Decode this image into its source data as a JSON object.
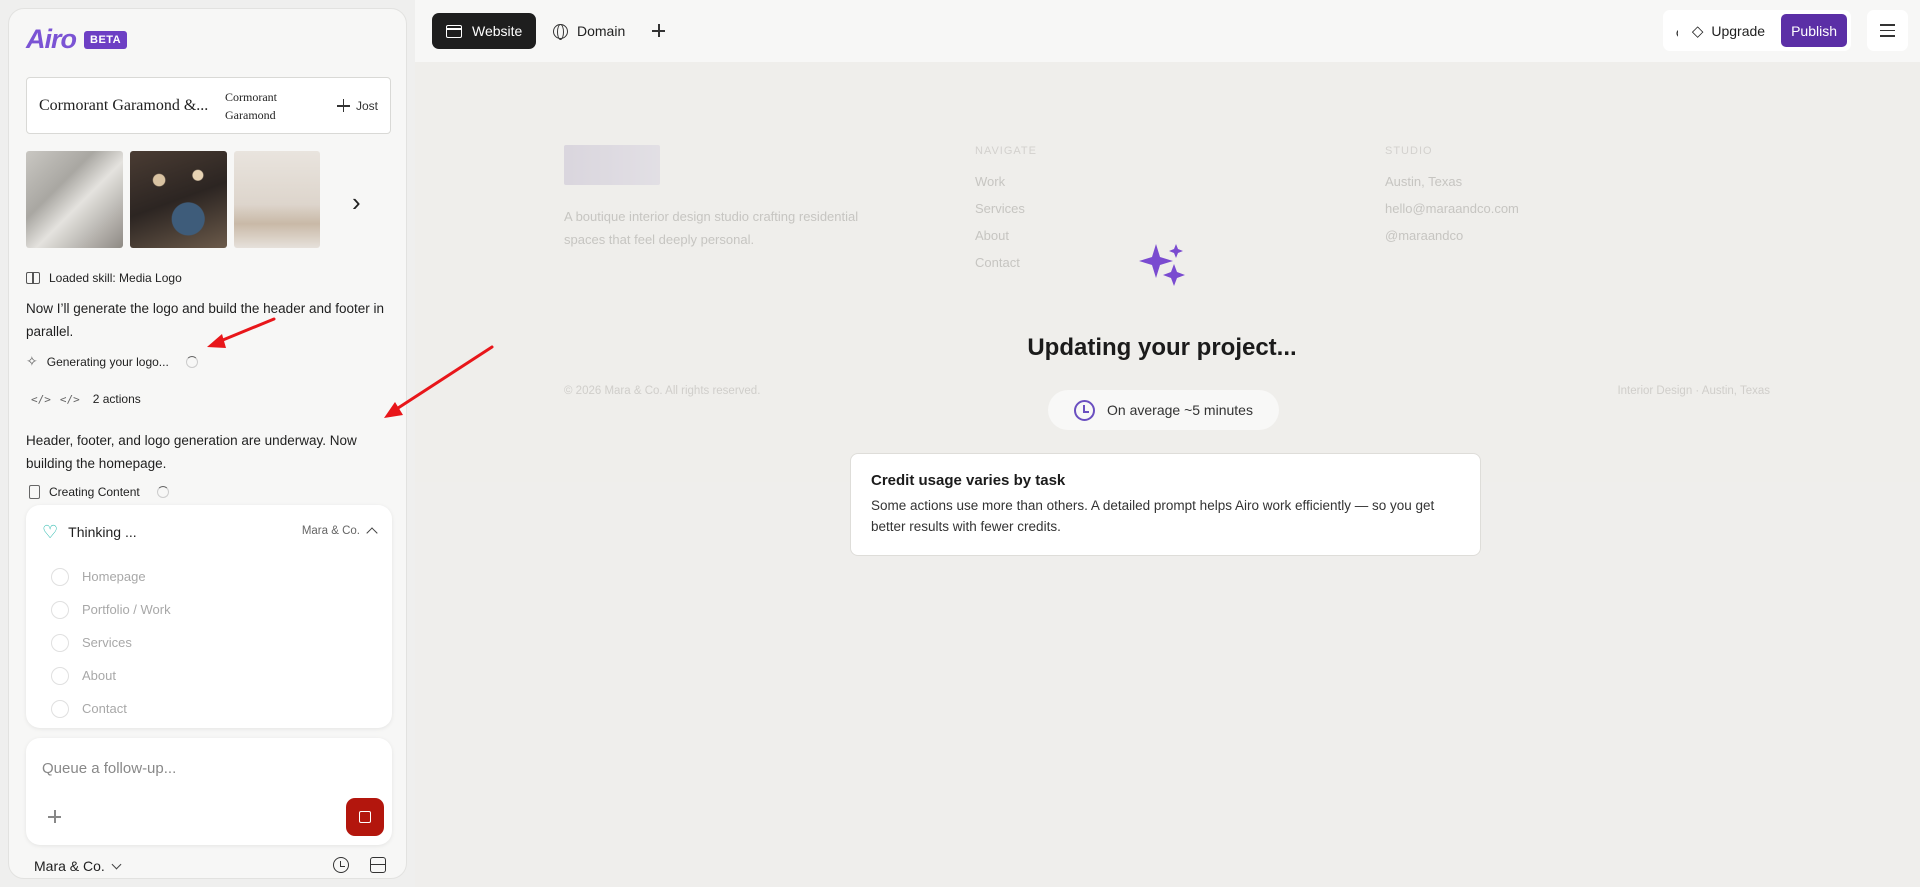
{
  "brand": {
    "name": "Airo",
    "badge": "BETA"
  },
  "font_card": {
    "primary": "Cormorant Garamond &...",
    "secondary": "Cormorant Garamond",
    "add_label": "Jost"
  },
  "chat": {
    "skill_loaded": "Loaded skill: Media Logo",
    "message_1": "Now I’ll generate the logo and build the header and footer in parallel.",
    "status_logo": "Generating your logo...",
    "actions_count": "2 actions",
    "message_2": "Header, footer, and logo generation are underway. Now building the homepage.",
    "status_content": "Creating Content"
  },
  "thinking": {
    "label": "Thinking ...",
    "project": "Mara & Co.",
    "pages": [
      "Homepage",
      "Portfolio / Work",
      "Services",
      "About",
      "Contact"
    ]
  },
  "composer": {
    "placeholder": "Queue a follow-up..."
  },
  "footer": {
    "project": "Mara & Co."
  },
  "topbar": {
    "tab_website": "Website",
    "tab_domain": "Domain",
    "upgrade": "Upgrade",
    "publish": "Publish"
  },
  "preview": {
    "about": "A boutique interior design studio crafting residential spaces that feel deeply personal.",
    "navigate_heading": "NAVIGATE",
    "navigate_items": [
      "Work",
      "Services",
      "About",
      "Contact"
    ],
    "studio_heading": "STUDIO",
    "studio_items": [
      "Austin, Texas",
      "hello@maraandco.com",
      "@maraandco"
    ],
    "copyright": "© 2026 Mara & Co. All rights reserved.",
    "tagline": "Interior Design · Austin, Texas"
  },
  "overlay": {
    "title": "Updating your project...",
    "average": "On average ~5 minutes",
    "credit_title": "Credit usage varies by task",
    "credit_body": "Some actions use more than others. A detailed prompt helps Airo work efficiently — so you get better results with fewer credits."
  },
  "colors": {
    "accent": "#5b2fa6",
    "stop": "#b3160d",
    "thinking_icon": "#16b3a6",
    "annotation": "#e8161a"
  },
  "icons": [
    "book-icon",
    "sparkle-icon",
    "code-icon",
    "document-icon",
    "heart-icon",
    "plus-icon",
    "stop-icon",
    "history-icon",
    "inbox-icon",
    "browser-icon",
    "globe-icon",
    "link-icon",
    "diamond-icon",
    "menu-icon",
    "clock-icon",
    "chevron-right-icon"
  ]
}
